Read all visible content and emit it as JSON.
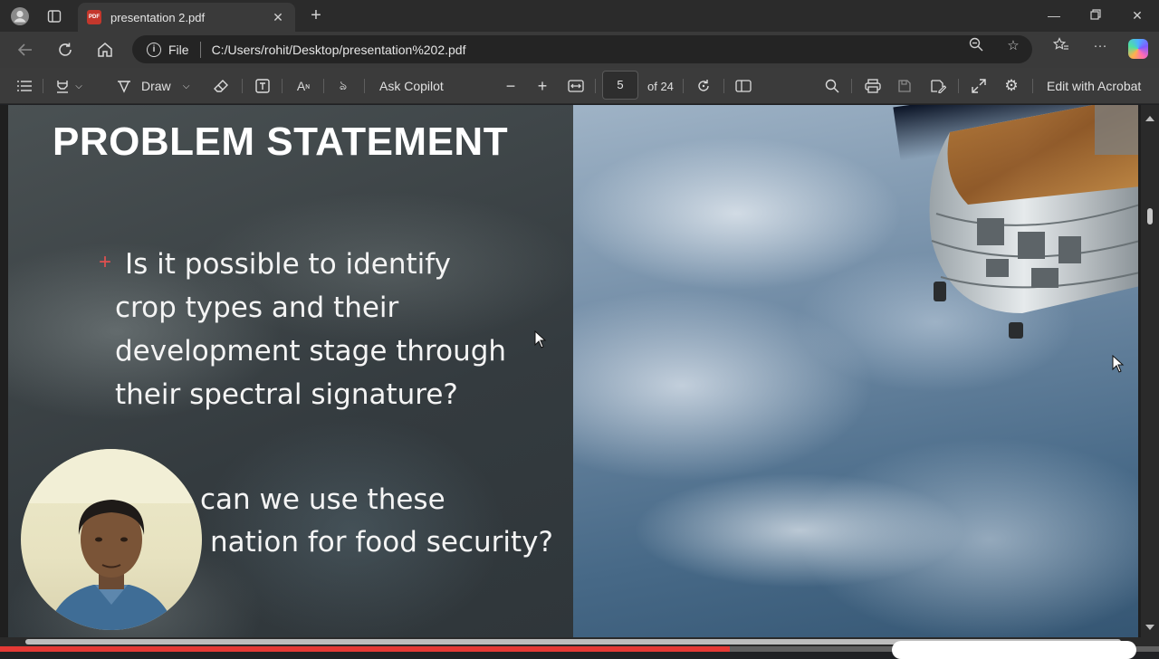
{
  "browser": {
    "tab_title": "presentation 2.pdf",
    "tab_icon_text": "PDF",
    "address": {
      "scheme_label": "File",
      "url": "C:/Users/rohit/Desktop/presentation%202.pdf"
    }
  },
  "pdf_toolbar": {
    "draw_label": "Draw",
    "ask_copilot_label": "Ask Copilot",
    "page_current": "5",
    "page_total_label": "of 24",
    "edit_acrobat_label": "Edit with Acrobat"
  },
  "slide": {
    "title": "PROBLEM STATEMENT",
    "bullet_1_lines": [
      "Is it possible to identify",
      "crop types and their",
      "development stage through",
      "their spectral signature?"
    ],
    "bullet_2_lines": [
      "can we use these",
      "nation for food security?"
    ]
  },
  "video_progress_fraction": 0.63,
  "colors": {
    "accent_red": "#e53935",
    "pdf_icon": "#c4372c"
  }
}
